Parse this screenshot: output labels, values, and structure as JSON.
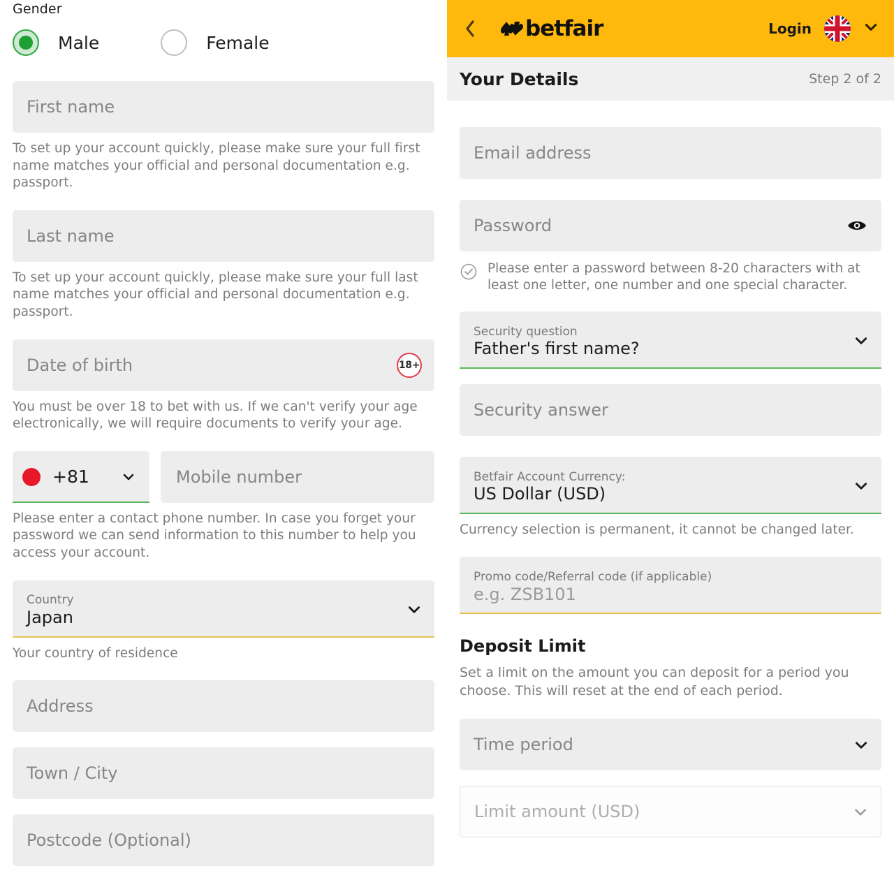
{
  "left": {
    "gender": {
      "label": "Gender",
      "options": [
        {
          "label": "Male",
          "selected": true
        },
        {
          "label": "Female",
          "selected": false
        }
      ]
    },
    "first_name": {
      "placeholder": "First name",
      "helper": "To set up your account quickly, please make sure your full first name matches your official and personal documentation e.g. passport."
    },
    "last_name": {
      "placeholder": "Last name",
      "helper": "To set up your account quickly, please make sure your full last name matches your official and personal documentation e.g. passport."
    },
    "date_of_birth": {
      "placeholder": "Date of birth",
      "badge": "18+",
      "helper": "You must be over 18 to bet with us. If we can't verify your age electronically, we will require documents to verify your age."
    },
    "phone": {
      "country_code": "+81",
      "flag": "jp-flag-icon",
      "placeholder": "Mobile number",
      "helper": "Please enter a contact phone number. In case you forget your password we can send information to this number to help you access your account."
    },
    "country": {
      "label": "Country",
      "value": "Japan",
      "helper": "Your country of residence"
    },
    "address": {
      "placeholder": "Address"
    },
    "town_city": {
      "placeholder": "Town / City"
    },
    "postcode": {
      "placeholder": "Postcode (Optional)"
    }
  },
  "right": {
    "topbar": {
      "back_icon": "chevron-left-icon",
      "brand": "betfair",
      "login_label": "Login",
      "flag": "uk-flag-icon",
      "flag_chevron": "chevron-down-icon"
    },
    "subbar": {
      "title": "Your Details",
      "step": "Step 2 of 2"
    },
    "email": {
      "placeholder": "Email address"
    },
    "password": {
      "placeholder": "Password",
      "toggle_icon": "eye-icon",
      "hint_icon": "check-circle-icon",
      "hint": "Please enter a password between 8-20 characters with at least one letter, one number and one special character."
    },
    "security_question": {
      "label": "Security question",
      "value": "Father's first name?"
    },
    "security_answer": {
      "placeholder": "Security answer"
    },
    "currency": {
      "label": "Betfair Account Currency:",
      "value": "US Dollar (USD)",
      "helper": "Currency selection is permanent, it cannot be changed later."
    },
    "promo": {
      "label": "Promo code/Referral code (if applicable)",
      "placeholder": "e.g. ZSB101"
    },
    "deposit_limit": {
      "heading": "Deposit Limit",
      "description": "Set a limit on the amount you can deposit for a period you choose. This will reset at the end of each period.",
      "time_period_placeholder": "Time period",
      "limit_amount_placeholder": "Limit amount (USD)"
    }
  },
  "colors": {
    "brand_yellow": "#ffb80c",
    "field_grey": "#ededed",
    "green_accent": "#5cb85c",
    "gold_accent": "#e8c15a",
    "age_red": "#e23b4a"
  }
}
